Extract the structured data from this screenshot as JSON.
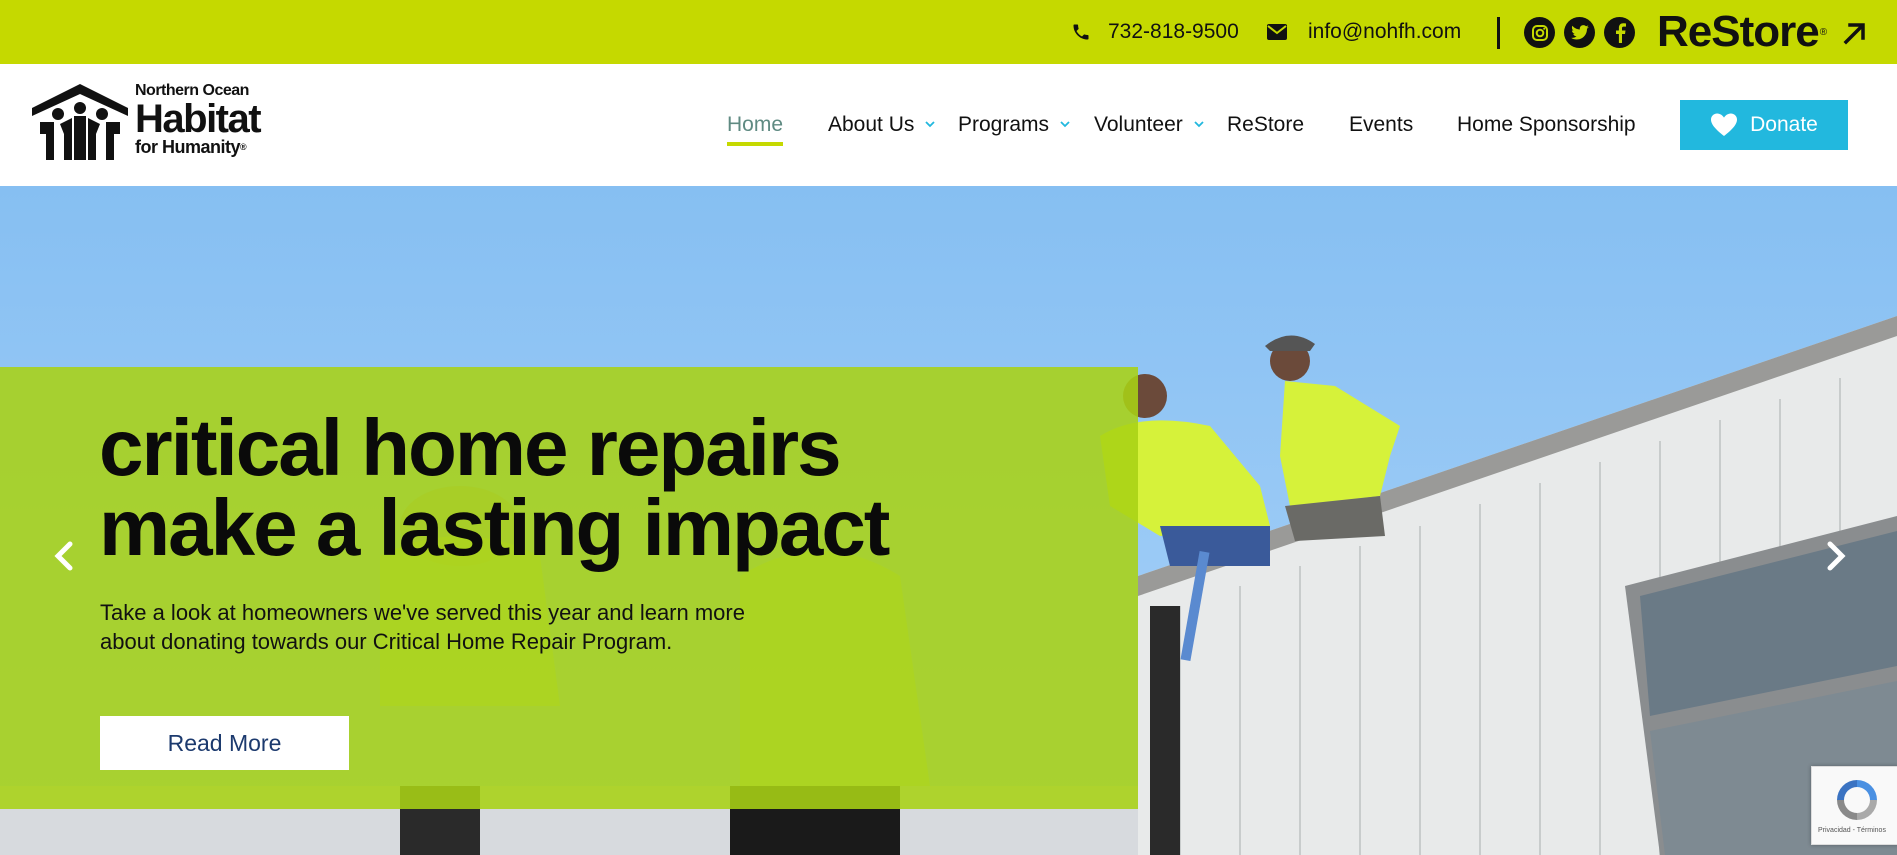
{
  "topbar": {
    "phone": "732-818-9500",
    "email": "info@nohfh.com",
    "social_icons": [
      "instagram-icon",
      "twitter-icon",
      "facebook-icon"
    ],
    "restore_logo": "ReStore"
  },
  "logo": {
    "line1": "Northern Ocean",
    "line2": "Habitat",
    "line3": "for Humanity"
  },
  "nav": {
    "items": [
      {
        "label": "Home",
        "active": true
      },
      {
        "label": "About Us",
        "has_dropdown": true
      },
      {
        "label": "Programs",
        "has_dropdown": true
      },
      {
        "label": "Volunteer",
        "has_dropdown": true
      },
      {
        "label": "ReStore"
      },
      {
        "label": "Events"
      },
      {
        "label": "Home Sponsorship"
      }
    ],
    "donate_label": "Donate"
  },
  "hero": {
    "title_line1": "critical home repairs",
    "title_line2": "make a lasting impact",
    "description": "Take a look at homeowners we've served this year and learn more about donating towards our Critical Home Repair Program.",
    "button_label": "Read More"
  },
  "recaptcha": {
    "footer": "Privacidad - Términos"
  },
  "colors": {
    "topbar": "#c5d900",
    "overlay": "#a8d214",
    "donate": "#22b8de",
    "active_nav": "#5f8a82"
  }
}
